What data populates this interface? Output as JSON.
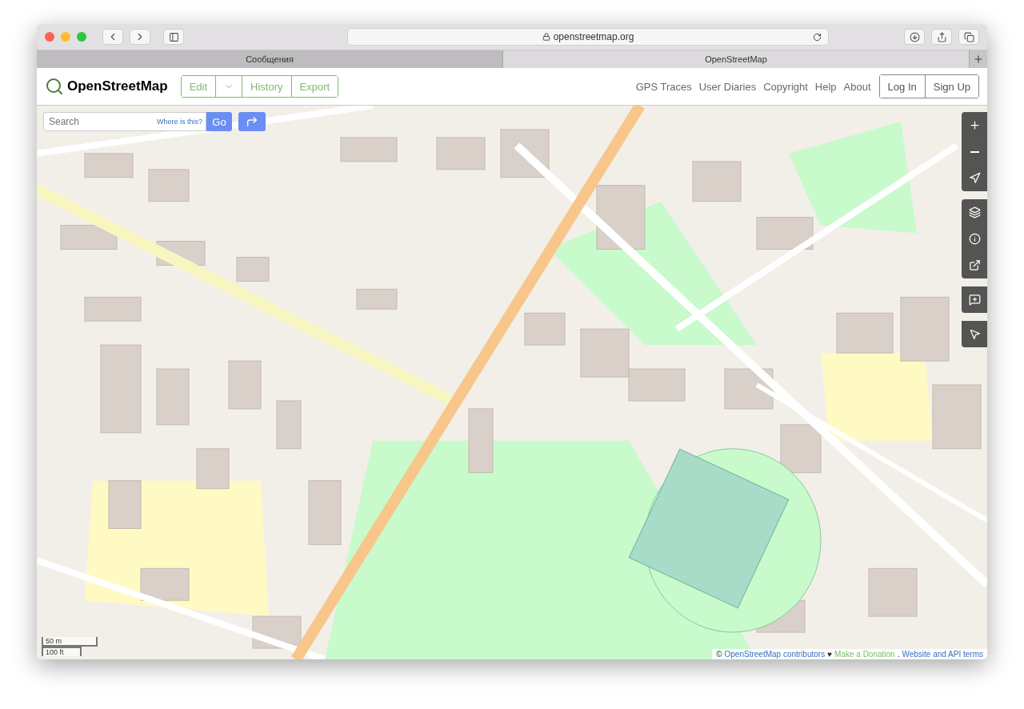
{
  "browser": {
    "url": "openstreetmap.org",
    "tabs": [
      {
        "label": "Сообщения",
        "selected": false
      },
      {
        "label": "OpenStreetMap",
        "selected": true
      }
    ]
  },
  "header": {
    "logo": "OpenStreetMap",
    "edit_group": [
      "Edit",
      "History",
      "Export"
    ],
    "nav_links": [
      "GPS Traces",
      "User Diaries",
      "Copyright",
      "Help",
      "About"
    ],
    "auth_buttons": [
      "Log In",
      "Sign Up"
    ]
  },
  "search": {
    "placeholder": "Search",
    "where_link": "Where is this?",
    "go": "Go"
  },
  "scale": [
    "50 m",
    "100 ft"
  ],
  "attribution": [
    {
      "text": "©",
      "kind": "text"
    },
    {
      "text": "OpenStreetMap contributors",
      "kind": "link"
    },
    {
      "text": "♥",
      "kind": "text"
    },
    {
      "text": "Make a Donation",
      "kind": "donate"
    },
    {
      "text": ".",
      "kind": "text"
    },
    {
      "text": "Website and API terms",
      "kind": "link"
    }
  ]
}
